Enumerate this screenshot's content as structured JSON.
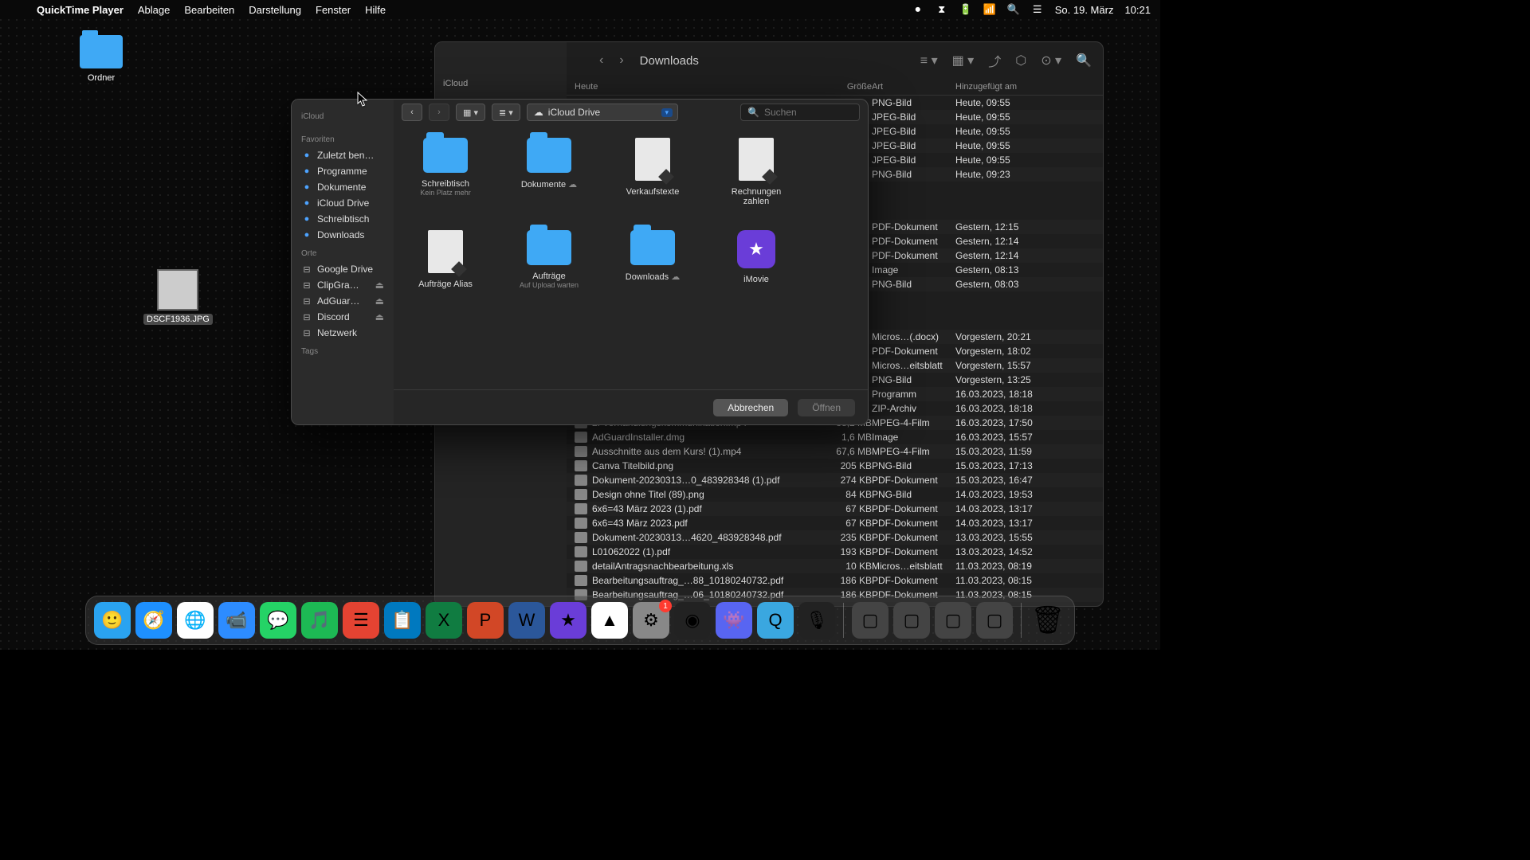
{
  "menubar": {
    "app": "QuickTime Player",
    "items": [
      "Ablage",
      "Bearbeiten",
      "Darstellung",
      "Fenster",
      "Hilfe"
    ],
    "date": "So. 19. März",
    "time": "10:21"
  },
  "desktop": {
    "folder_label": "Ordner",
    "thumb_label": "DSCF1936.JPG"
  },
  "finder": {
    "sidebar_section": "iCloud",
    "title": "Downloads",
    "columns": {
      "date": "Heute",
      "size": "Größe",
      "kind": "Art",
      "added": "Hinzugefügt am"
    },
    "top_rows": [
      {
        "kind": "PNG-Bild",
        "added": "Heute, 09:55"
      },
      {
        "kind": "JPEG-Bild",
        "added": "Heute, 09:55"
      },
      {
        "kind": "JPEG-Bild",
        "added": "Heute, 09:55"
      },
      {
        "kind": "JPEG-Bild",
        "added": "Heute, 09:55"
      },
      {
        "kind": "JPEG-Bild",
        "added": "Heute, 09:55"
      },
      {
        "kind": "PNG-Bild",
        "added": "Heute, 09:23"
      }
    ],
    "mid_rows": [
      {
        "kind": "PDF-Dokument",
        "added": "Gestern, 12:15"
      },
      {
        "kind": "PDF-Dokument",
        "added": "Gestern, 12:14"
      },
      {
        "kind": "PDF-Dokument",
        "added": "Gestern, 12:14"
      },
      {
        "kind": "Image",
        "added": "Gestern, 08:13"
      },
      {
        "kind": "PNG-Bild",
        "added": "Gestern, 08:03"
      }
    ],
    "mid2_rows": [
      {
        "kind": "Micros…(.docx)",
        "added": "Vorgestern, 20:21"
      },
      {
        "kind": "PDF-Dokument",
        "added": "Vorgestern, 18:02"
      },
      {
        "kind": "Micros…eitsblatt",
        "added": "Vorgestern, 15:57"
      },
      {
        "kind": "PNG-Bild",
        "added": "Vorgestern, 13:25"
      },
      {
        "kind": "Programm",
        "added": "16.03.2023, 18:18"
      },
      {
        "kind": "ZIP-Archiv",
        "added": "16.03.2023, 18:18"
      }
    ],
    "files": [
      {
        "name": "2. Verhandlungskommunikation.mp4",
        "size": "88,2 MB",
        "kind": "MPEG-4-Film",
        "added": "16.03.2023, 17:50"
      },
      {
        "name": "AdGuardInstaller.dmg",
        "size": "1,6 MB",
        "kind": "Image",
        "added": "16.03.2023, 15:57"
      },
      {
        "name": "Ausschnitte aus dem Kurs! (1).mp4",
        "size": "67,6 MB",
        "kind": "MPEG-4-Film",
        "added": "15.03.2023, 11:59"
      },
      {
        "name": "Canva Titelbild.png",
        "size": "205 KB",
        "kind": "PNG-Bild",
        "added": "15.03.2023, 17:13"
      },
      {
        "name": "Dokument-20230313…0_483928348 (1).pdf",
        "size": "274 KB",
        "kind": "PDF-Dokument",
        "added": "15.03.2023, 16:47"
      },
      {
        "name": "Design ohne Titel (89).png",
        "size": "84 KB",
        "kind": "PNG-Bild",
        "added": "14.03.2023, 19:53"
      },
      {
        "name": "6x6=43 März 2023 (1).pdf",
        "size": "67 KB",
        "kind": "PDF-Dokument",
        "added": "14.03.2023, 13:17"
      },
      {
        "name": "6x6=43 März 2023.pdf",
        "size": "67 KB",
        "kind": "PDF-Dokument",
        "added": "14.03.2023, 13:17"
      },
      {
        "name": "Dokument-20230313…4620_483928348.pdf",
        "size": "235 KB",
        "kind": "PDF-Dokument",
        "added": "13.03.2023, 15:55"
      },
      {
        "name": "L01062022 (1).pdf",
        "size": "193 KB",
        "kind": "PDF-Dokument",
        "added": "13.03.2023, 14:52"
      },
      {
        "name": "detailAntragsnachbearbeitung.xls",
        "size": "10 KB",
        "kind": "Micros…eitsblatt",
        "added": "11.03.2023, 08:19"
      },
      {
        "name": "Bearbeitungsauftrag_…88_10180240732.pdf",
        "size": "186 KB",
        "kind": "PDF-Dokument",
        "added": "11.03.2023, 08:15"
      },
      {
        "name": "Bearbeitungsauftrag_…06_10180240732.pdf",
        "size": "186 KB",
        "kind": "PDF-Dokument",
        "added": "11.03.2023, 08:15"
      }
    ]
  },
  "dialog": {
    "sections": {
      "icloud": "iCloud",
      "fav": "Favoriten",
      "orte": "Orte",
      "tags": "Tags"
    },
    "fav_items": [
      "Zuletzt ben…",
      "Programme",
      "Dokumente",
      "iCloud Drive",
      "Schreibtisch",
      "Downloads"
    ],
    "orte_items": [
      "Google Drive",
      "ClipGra…",
      "AdGuar…",
      "Discord",
      "Netzwerk"
    ],
    "path": "iCloud Drive",
    "search_placeholder": "Suchen",
    "items": [
      {
        "label": "Schreibtisch",
        "sub": "Kein Platz mehr",
        "type": "folder"
      },
      {
        "label": "Dokumente",
        "sub": "",
        "type": "folder",
        "cloud": true
      },
      {
        "label": "Verkaufstexte",
        "sub": "",
        "type": "doc"
      },
      {
        "label": "Rechnungen zahlen",
        "sub": "",
        "type": "doc"
      },
      {
        "label": "Aufträge Alias",
        "sub": "",
        "type": "doc"
      },
      {
        "label": "Aufträge",
        "sub": "Auf Upload warten",
        "type": "folder"
      },
      {
        "label": "Downloads",
        "sub": "",
        "type": "folder",
        "cloud": true
      },
      {
        "label": "iMovie",
        "sub": "",
        "type": "imovie"
      }
    ],
    "cancel": "Abbrechen",
    "open": "Öffnen"
  },
  "dock": {
    "apps": [
      {
        "name": "finder",
        "bg": "#2aa3f0",
        "glyph": "🙂"
      },
      {
        "name": "safari",
        "bg": "#1e90ff",
        "glyph": "🧭"
      },
      {
        "name": "chrome",
        "bg": "#fff",
        "glyph": "🌐"
      },
      {
        "name": "zoom",
        "bg": "#2d8cff",
        "glyph": "📹"
      },
      {
        "name": "whatsapp",
        "bg": "#25d366",
        "glyph": "💬"
      },
      {
        "name": "spotify",
        "bg": "#1db954",
        "glyph": "🎵"
      },
      {
        "name": "todoist",
        "bg": "#e44332",
        "glyph": "☰"
      },
      {
        "name": "trello",
        "bg": "#0079bf",
        "glyph": "📋"
      },
      {
        "name": "excel",
        "bg": "#107c41",
        "glyph": "X"
      },
      {
        "name": "powerpoint",
        "bg": "#d24726",
        "glyph": "P"
      },
      {
        "name": "word",
        "bg": "#2b579a",
        "glyph": "W"
      },
      {
        "name": "imovie",
        "bg": "#6a3dd8",
        "glyph": "★"
      },
      {
        "name": "drive",
        "bg": "#fff",
        "glyph": "▲"
      },
      {
        "name": "settings",
        "bg": "#888",
        "glyph": "⚙",
        "badge": "1"
      },
      {
        "name": "siri",
        "bg": "#222",
        "glyph": "◉"
      },
      {
        "name": "discord",
        "bg": "#5865f2",
        "glyph": "👾"
      },
      {
        "name": "quicktime",
        "bg": "#3aa7e0",
        "glyph": "Q"
      },
      {
        "name": "audio",
        "bg": "#222",
        "glyph": "🎙"
      }
    ]
  }
}
